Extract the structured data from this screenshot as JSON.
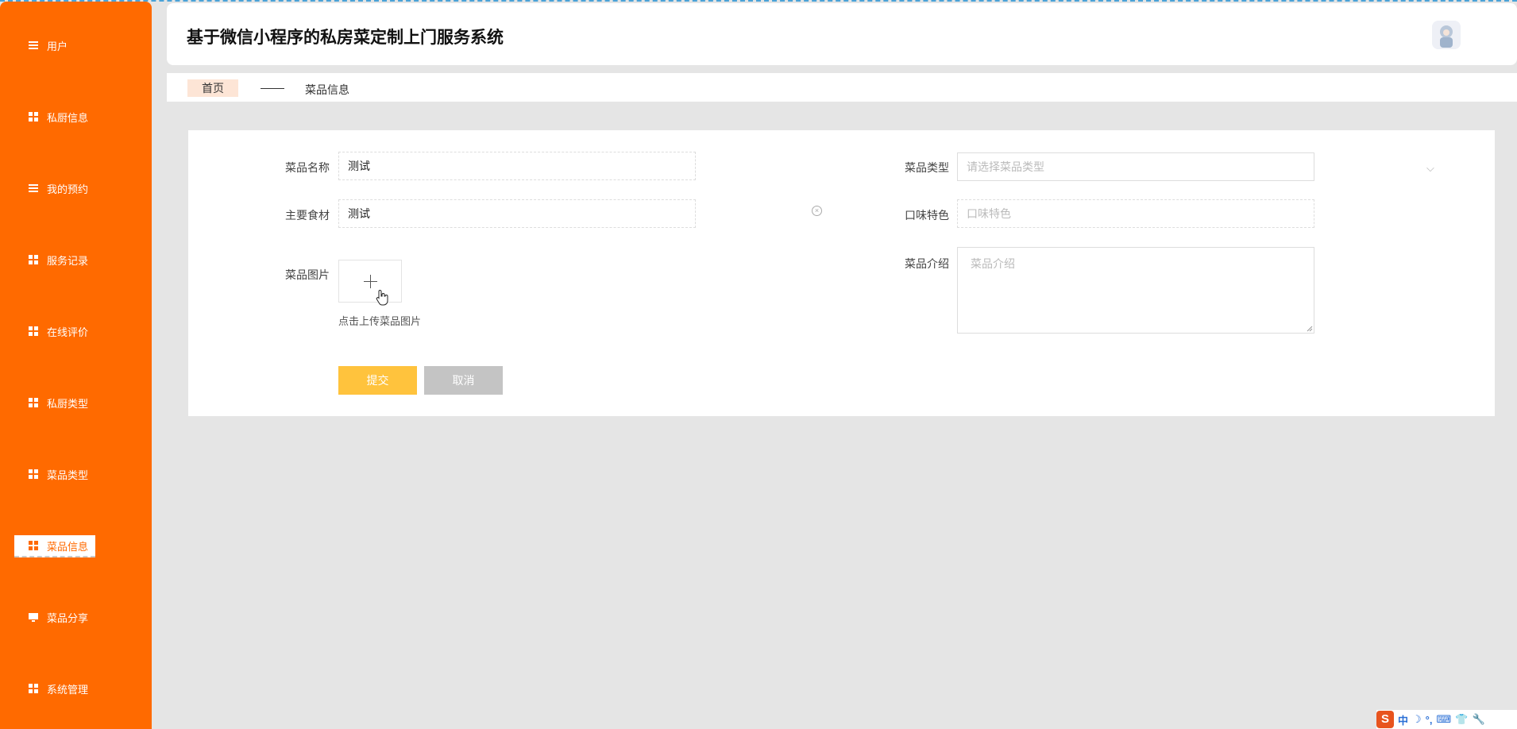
{
  "sidebar": {
    "items": [
      {
        "label": "用户",
        "icon": "list-icon"
      },
      {
        "label": "私厨信息",
        "icon": "grid-icon"
      },
      {
        "label": "我的预约",
        "icon": "list-icon"
      },
      {
        "label": "服务记录",
        "icon": "grid-icon"
      },
      {
        "label": "在线评价",
        "icon": "grid-icon"
      },
      {
        "label": "私厨类型",
        "icon": "grid-icon"
      },
      {
        "label": "菜品类型",
        "icon": "grid-icon"
      },
      {
        "label": "菜品信息",
        "icon": "grid-icon",
        "active": true
      },
      {
        "label": "菜品分享",
        "icon": "monitor-icon"
      },
      {
        "label": "系统管理",
        "icon": "grid-icon"
      }
    ]
  },
  "header": {
    "title": "基于微信小程序的私房菜定制上门服务系统"
  },
  "breadcrumb": {
    "home": "首页",
    "current": "菜品信息"
  },
  "form": {
    "dish_name": {
      "label": "菜品名称",
      "value": "测试"
    },
    "dish_type": {
      "label": "菜品类型",
      "placeholder": "请选择菜品类型"
    },
    "main_ingredients": {
      "label": "主要食材",
      "value": "测试"
    },
    "flavor": {
      "label": "口味特色",
      "placeholder": "口味特色"
    },
    "dish_image": {
      "label": "菜品图片",
      "hint": "点击上传菜品图片"
    },
    "intro": {
      "label": "菜品介绍",
      "placeholder": "菜品介绍"
    },
    "submit_label": "提交",
    "cancel_label": "取消"
  },
  "tray": {
    "ime_logo": "S",
    "ime_mode": "中",
    "extra": "°,"
  },
  "colors": {
    "sidebar": "#ff6a00",
    "submit": "#ffc33d",
    "cancel": "#c4c4c4",
    "breadcrumb_home_bg": "#fde5d6"
  }
}
